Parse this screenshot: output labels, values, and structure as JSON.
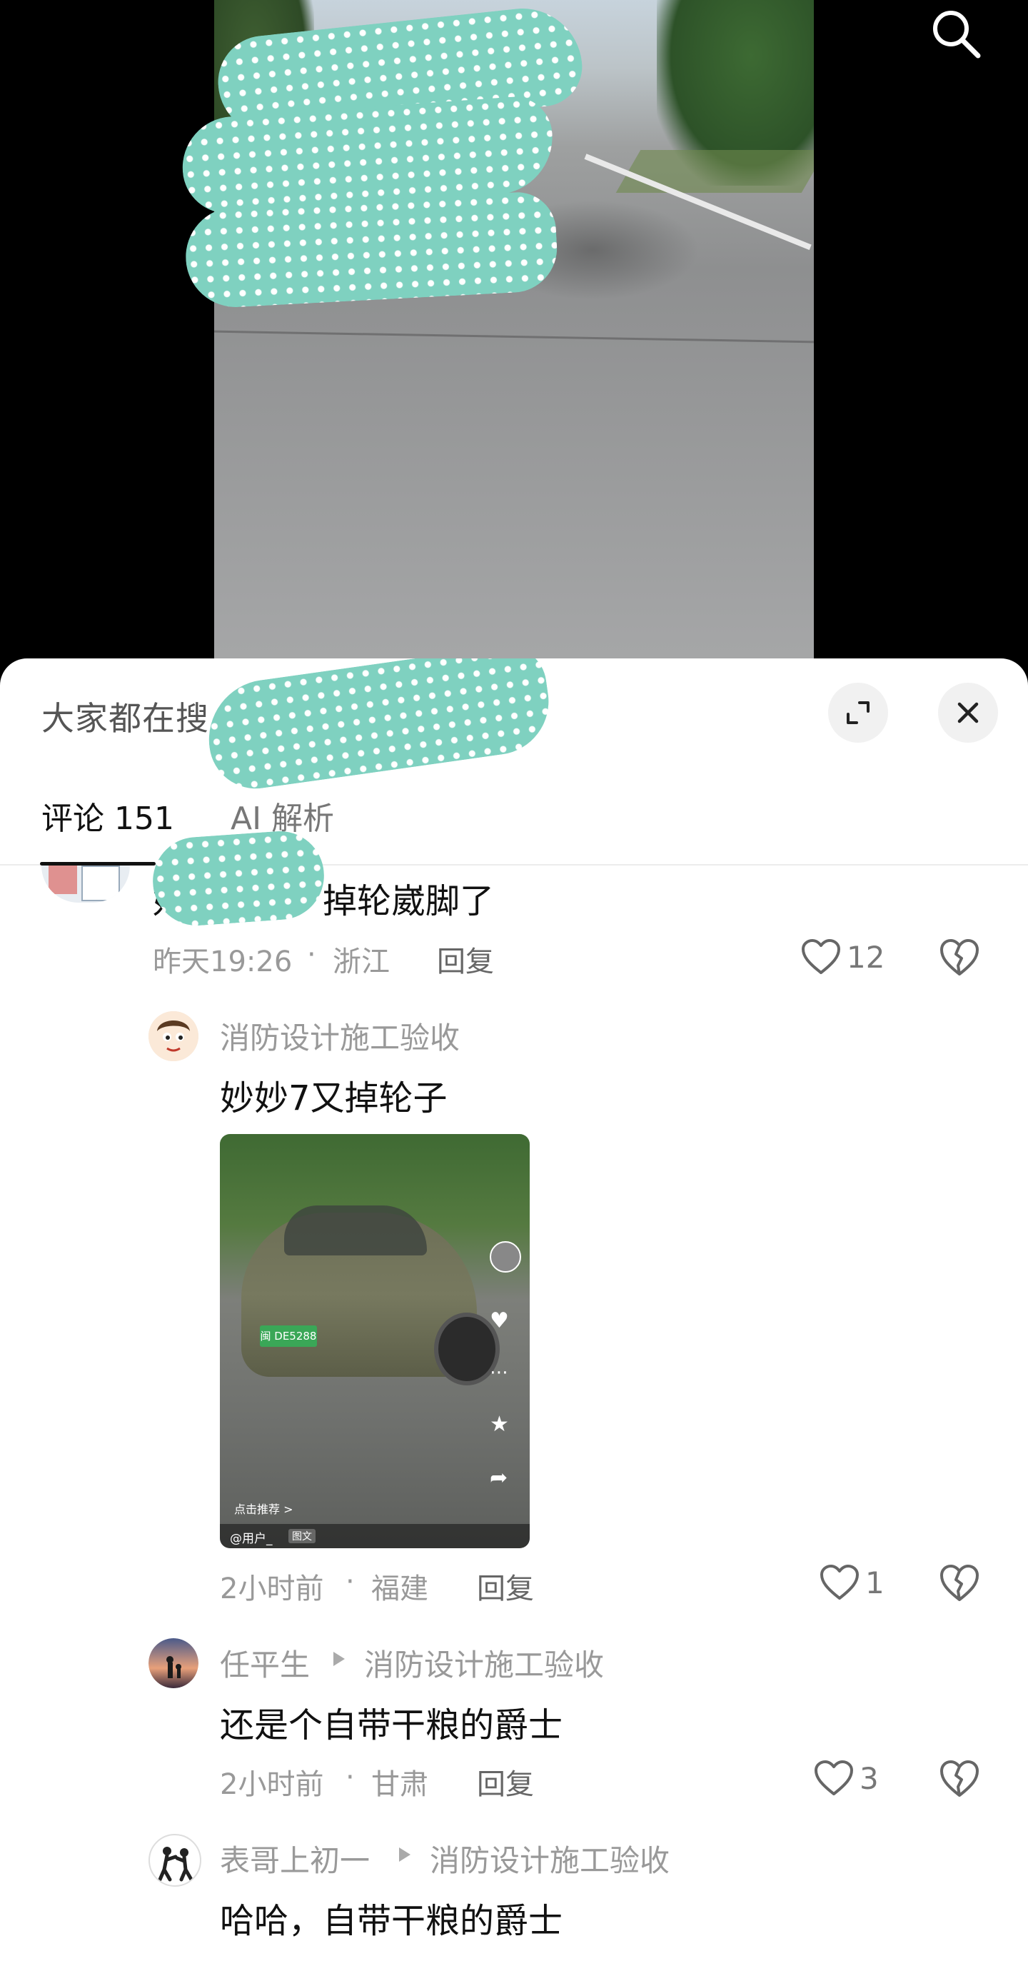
{
  "colors": {
    "accent": "#111111",
    "meta_gray": "#999999",
    "sheet_bg": "#ffffff",
    "scribble": "#7fd1c0"
  },
  "header": {
    "search_hint": "大家都在搜"
  },
  "tabs": {
    "comments_label": "评论",
    "comments_count": "151",
    "ai_label": "AI 解析"
  },
  "comments": [
    {
      "text_prefix": "好",
      "text": "掉轮崴脚了",
      "time": "昨天19:26",
      "location": "浙江",
      "reply": "回复",
      "likes": "12",
      "avatar_icon": "photo-thumbnail-avatar"
    },
    {
      "author": "消防设计施工验收",
      "text": "妙妙7又掉轮子",
      "time": "2小时前",
      "location": "福建",
      "reply": "回复",
      "likes": "1",
      "avatar_icon": "cartoon-boy-avatar",
      "image": {
        "plate": "闽 DE5288",
        "recommend": "点击推荐 >",
        "user": "@用户_",
        "tag": "图文"
      }
    },
    {
      "author": "任平生",
      "reply_to": "消防设计施工验收",
      "text": "还是个自带干粮的爵士",
      "time": "2小时前",
      "location": "甘肃",
      "reply": "回复",
      "likes": "3",
      "avatar_icon": "sunset-silhouette-avatar"
    },
    {
      "author": "表哥上初一",
      "reply_to": "消防设计施工验收",
      "text": "哈哈，自带干粮的爵士",
      "avatar_icon": "fighting-figures-avatar"
    }
  ],
  "icons": {
    "search": "search-icon",
    "expand": "expand-icon",
    "close": "close-icon",
    "like": "heart-icon",
    "dislike": "broken-heart-icon",
    "arrow": "play-arrow-icon"
  },
  "separator": "·"
}
